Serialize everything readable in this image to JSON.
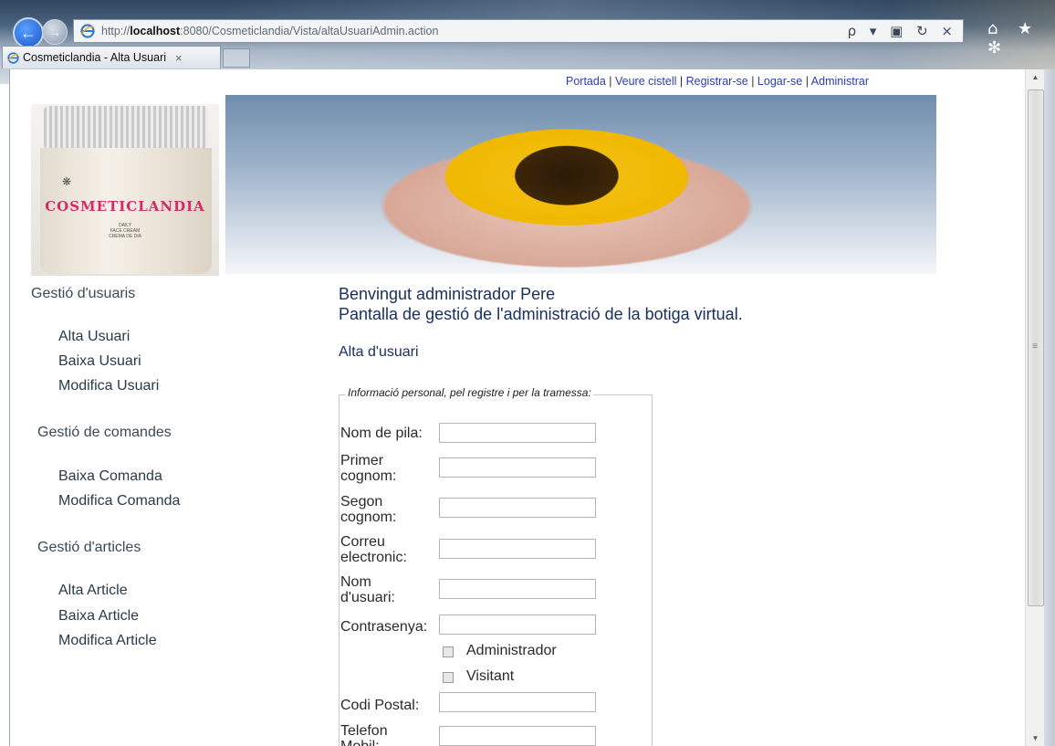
{
  "browser": {
    "url_prefix": "http://",
    "url_host": "localhost",
    "url_rest": ":8080/Cosmeticlandia/Vista/altaUsuariAdmin.action",
    "tab_title": "Cosmeticlandia - Alta Usuari",
    "tab_close": "×",
    "addr_tools": "ρ ▾ ▣ ↻ ×",
    "right_tools": "⌂ ★ ✻"
  },
  "top_links": {
    "portada": "Portada",
    "veure_cistell": "Veure cistell",
    "registrar": "Registrar-se",
    "logar": "Logar-se",
    "administrar": "Administrar",
    "separator": "|"
  },
  "logo": {
    "brand": "COSMETICLANDIA",
    "line1": "DAILY",
    "line2": "FACE CREAM",
    "line3": "CREMA DE DIA"
  },
  "sidebar": {
    "users_heading": "Gestió d'usuaris",
    "users_items": [
      "Alta Usuari",
      "Baixa Usuari",
      "Modifica Usuari"
    ],
    "orders_heading": "Gestió de comandes",
    "orders_items": [
      "Baixa Comanda",
      "Modifica Comanda"
    ],
    "articles_heading": "Gestió d'articles",
    "articles_items": [
      "Alta Article",
      "Baixa Article",
      "Modifica Article"
    ]
  },
  "main": {
    "welcome": "Benvingut administrador Pere",
    "subtitle": "Pantalla de gestió de l'administració de la botiga virtual.",
    "section_title": "Alta d'usuari",
    "legend": "Informació personal, pel registre i per la tramessa:"
  },
  "form": {
    "nom_label": "Nom de pila:",
    "cognom1_label_a": "Primer",
    "cognom1_label_b": "cognom:",
    "cognom2_label_a": "Segon",
    "cognom2_label_b": "cognom:",
    "correu_label_a": "Correu",
    "correu_label_b": "electronic:",
    "usuari_label_a": "Nom",
    "usuari_label_b": "d'usuari:",
    "contrasenya_label": "Contrasenya:",
    "admin_label": "Administrador",
    "visitant_label": "Visitant",
    "codi_postal_label": "Codi Postal:",
    "telefon_label_a": "Telefon",
    "telefon_label_b": "Mobil:",
    "nom_value": "",
    "cognom1_value": "",
    "cognom2_value": "",
    "correu_value": "",
    "usuari_value": "",
    "contrasenya_value": "",
    "codi_postal_value": "",
    "telefon_value": ""
  },
  "scrollbar": {
    "up": "▲",
    "down": "▼",
    "grip": "≡"
  }
}
